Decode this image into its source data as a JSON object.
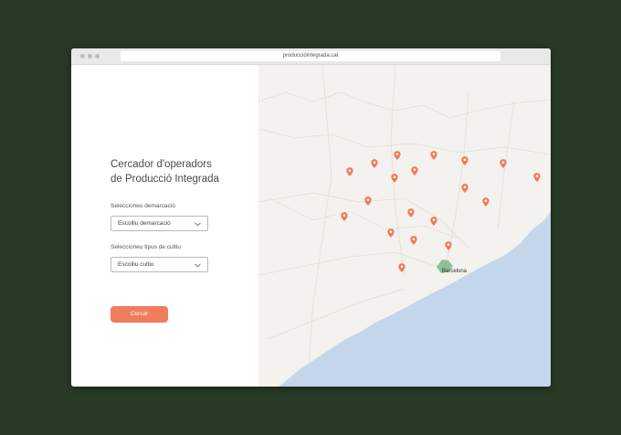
{
  "browser": {
    "url": "produccióintegrada.cat"
  },
  "panel": {
    "title_line1": "Cercador d'operadors",
    "title_line2": "de Producció Integrada",
    "demarcacio_label": "Seleccioneu demarcació",
    "demarcacio_value": "Escolliu demarcació",
    "cultiu_label": "Seleccioneu tipus de cultiu",
    "cultiu_value": "Escolliu cultiu",
    "search_button": "Cercar"
  },
  "map": {
    "city_label": "Barcelona",
    "marker_color": "#ef7a5a",
    "sea_color": "#c3d6ea",
    "land_color": "#f3f2ee",
    "marker_count": 19
  }
}
